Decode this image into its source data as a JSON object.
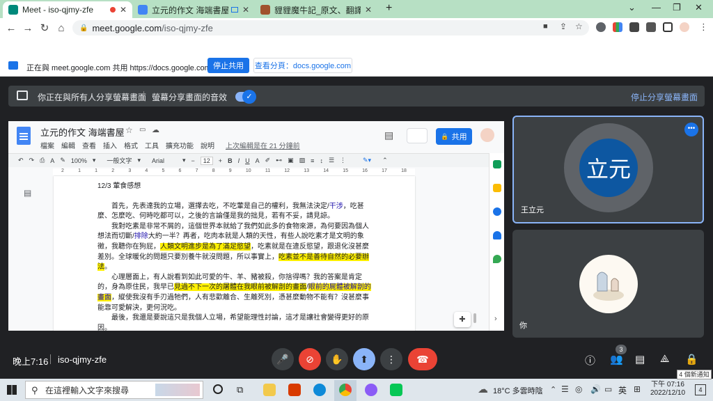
{
  "browser": {
    "tabs": [
      {
        "title": "Meet - iso-qjmy-zfe",
        "active": true,
        "recording": true
      },
      {
        "title": "立元的作文 海端書屋 - Goo",
        "active": false
      },
      {
        "title": "貍貍魔牛記_原文、翻譯及賞析_",
        "active": false
      }
    ],
    "new_tab": "+",
    "window_controls": [
      "⌄",
      "—",
      "❐",
      "✕"
    ],
    "url_host": "meet.google.com",
    "url_path": "/iso-qjmy-zfe"
  },
  "sharebar": {
    "text": "正在與 meet.google.com 共用 https://docs.google.com",
    "stop_button": "停止共用",
    "view_tab_button": "查看分頁：docs.google.com"
  },
  "meetbar": {
    "presenting_text": "你正在與所有人分享螢幕畫面",
    "audio_text": "螢幕分享畫面的音效",
    "stop_link": "停止分享螢幕畫面"
  },
  "docs": {
    "title": "立元的作文 海端書屋",
    "menu": [
      "檔案",
      "編輯",
      "查看",
      "插入",
      "格式",
      "工具",
      "擴充功能",
      "說明"
    ],
    "last_edit": "上次編輯是在 21 分鐘前",
    "share_button": "共用",
    "toolbar": {
      "zoom": "100%",
      "style": "一般文字",
      "font": "Arial",
      "size": "12"
    },
    "ruler_marks": [
      "2",
      "1",
      "1",
      "2",
      "3",
      "4",
      "5",
      "6",
      "7",
      "8",
      "9",
      "10",
      "11",
      "12",
      "13",
      "14",
      "15",
      "16",
      "17",
      "18"
    ],
    "heading": "12/3 葷食感想",
    "p1a": "首先，先表達我的立場，選擇去吃，不吃葷是自己的權利，我無法決定/",
    "p1_blue": "干涉",
    "p1b": "，吃甚麼、怎麼吃、何時吃都可以，之後的言論僅是我的拙見，若有不妥，請見諒。",
    "p2a": "我對吃素是非常不屑的，這個世界本就給了我們如此多的食物來源，為何要因為個人想法而切斷/",
    "p2_blue": "排除",
    "p2b": "大約一半？再者，吃肉本就是人類的天性，有些人說吃素才是文明的象徵，我聽你在狗屁，",
    "p2_hl": "人類文明進步是為了滿足慾望",
    "p2c": "，吃素就是在違反慾望，跟退化沒甚麼差別。全球暖化的問題只要別養牛就沒問題，所以事實上，",
    "p2_hl2": "吃素並不是善待自然的必要辦法",
    "p2d": "。",
    "p3a": "心理層面上，有人說看到如此可愛的牛、羊、豬被殺，你捨得嗎？我的答案是肯定的，身為原住民，我早已",
    "p3_hl": "見過不下一次的屠體在我眼前被解剖的畫面",
    "p3_sep": "/",
    "p3_blue": "眼前的屍體被解剖的畫面",
    "p3b": "，縱使我沒有手刃過牠們，人有悲歡離合、生離死別，憑甚麼動物不能有？沒甚麼事能靠可愛解決，更何況吃。",
    "p4": "最後，我還是要說這只是我個人立場，希望能理性討論，這才是讓社會變得更好的原因。"
  },
  "participants": [
    {
      "name": "王立元",
      "initials": "立元",
      "color": "#0d57a1"
    },
    {
      "name": "你"
    }
  ],
  "controls": {
    "time": "晚上7:16",
    "meeting_code": "iso-qjmy-zfe",
    "participant_count": "3"
  },
  "taskbar": {
    "search_placeholder": "在這裡輸入文字來搜尋",
    "weather": "18°C 多雲時陰",
    "ime": "英",
    "clock_time": "下午 07:16",
    "clock_date": "2022/12/10",
    "notification_tip": "4 個新通知",
    "notification_count": "4"
  }
}
